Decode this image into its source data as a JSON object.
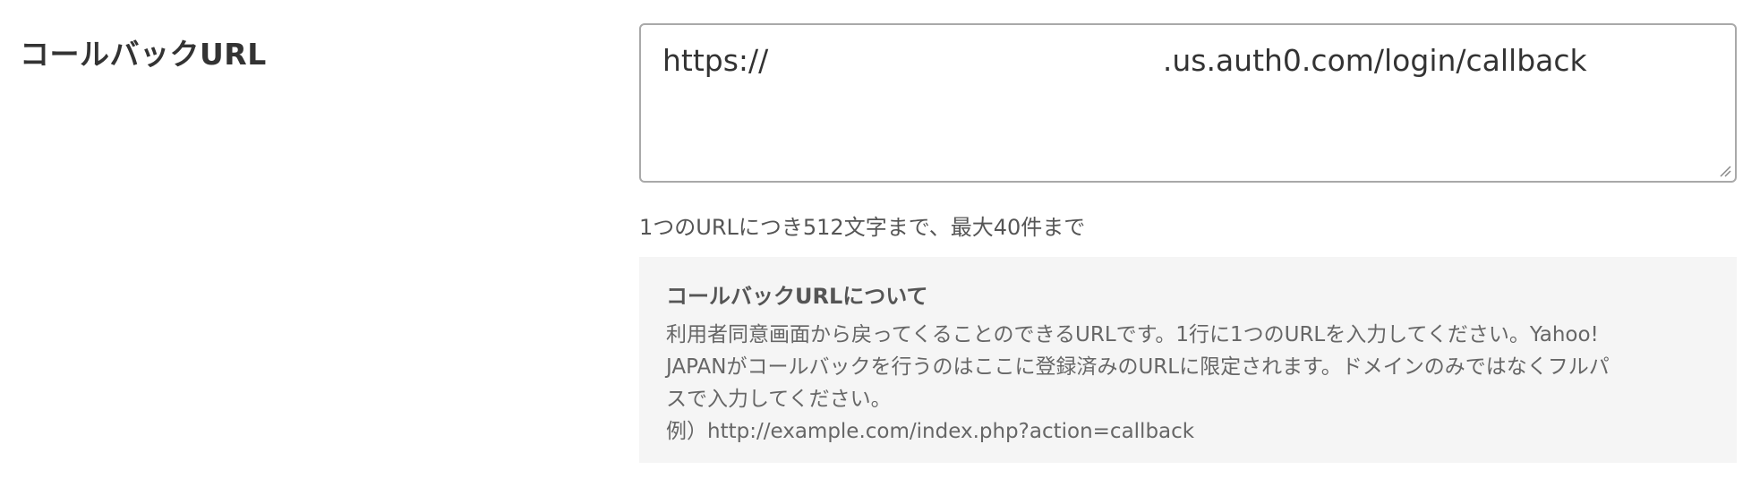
{
  "field": {
    "label": "コールバックURL"
  },
  "callback_url": {
    "value": "https://                                          .us.auth0.com/login/callback"
  },
  "hint": "1つのURLにつき512文字まで、最大40件まで",
  "info": {
    "title": "コールバックURLについて",
    "lines": [
      "利用者同意画面から戻ってくることのできるURLです。1行に1つのURLを入力してください。Yahoo!",
      "JAPANがコールバックを行うのはここに登録済みのURLに限定されます。ドメインのみではなくフルパ",
      "スで入力してください。",
      "例）http://example.com/index.php?action=callback"
    ]
  },
  "colors": {
    "text": "#333333",
    "hint": "#555555",
    "info_background": "#f5f5f5",
    "border": "#a9a9a9"
  },
  "icons": {
    "resize": "resize-grip-icon"
  }
}
